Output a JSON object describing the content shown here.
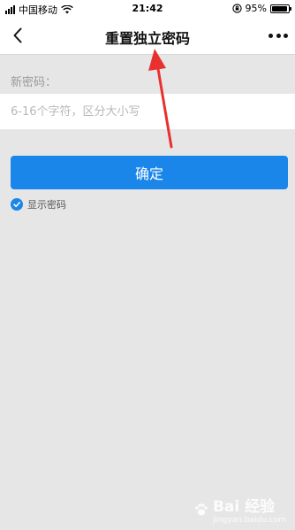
{
  "status_bar": {
    "carrier": "中国移动",
    "time": "21:42",
    "battery": "95%",
    "battery_level": 0.95
  },
  "nav": {
    "title": "重置独立密码"
  },
  "form": {
    "label": "新密码：",
    "placeholder": "6-16个字符，区分大小写",
    "value": ""
  },
  "confirm_label": "确定",
  "show_password": {
    "label": "显示密码",
    "checked": true
  },
  "watermark": {
    "brand": "Bai 经验",
    "url": "jingyan.baidu.com"
  },
  "colors": {
    "accent": "#1a86ea",
    "annotation": "#e8312f",
    "background": "#e6e6e6"
  }
}
